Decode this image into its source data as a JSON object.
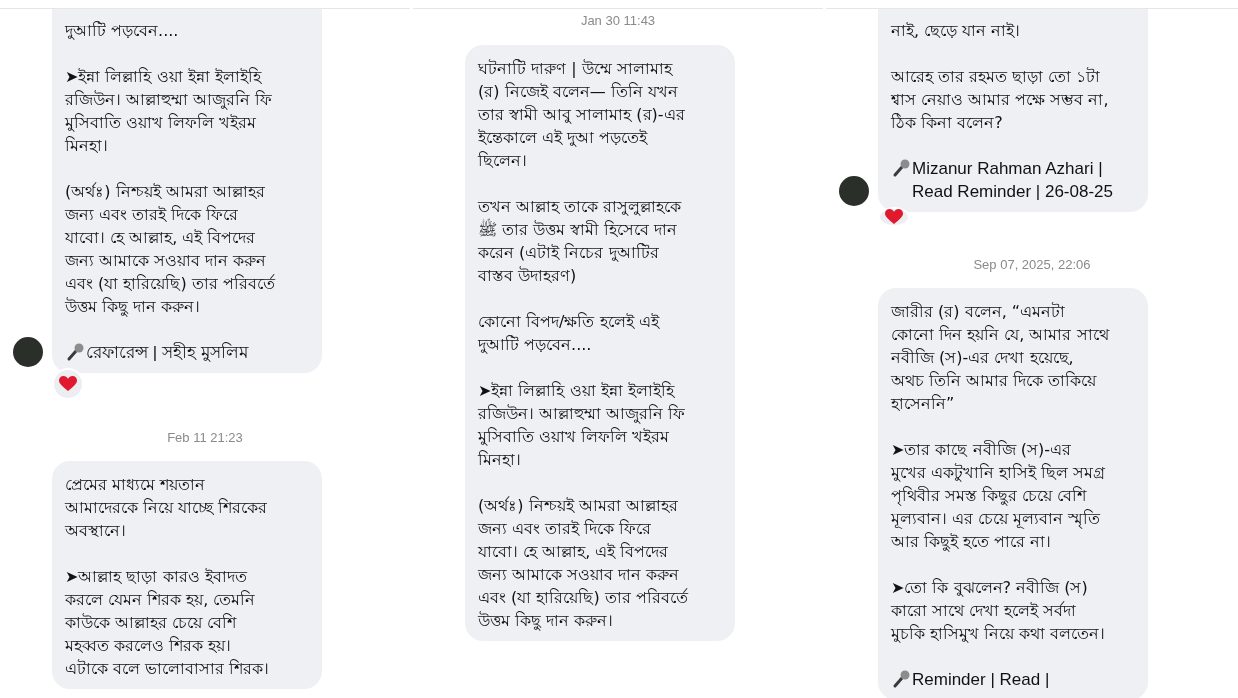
{
  "panels": [
    {
      "items": [
        {
          "kind": "message",
          "cut_top": true,
          "avatar": true,
          "heart_reaction": true,
          "paragraphs": [
            {
              "kind": "text",
              "lines": [
                "দুআটি পড়বেন...."
              ]
            },
            {
              "kind": "text",
              "lines": [
                "➤ইন্না লিল্লাহি ওয়া ইন্না ইলাইহি",
                "রজিউন। আল্লাহুম্মা আজুরনি ফি",
                "মুসিবাতি ওয়াখ লিফলি খইরম",
                "মিনহা।"
              ]
            },
            {
              "kind": "text",
              "lines": [
                "(অর্থঃ) নিশ্চয়ই আমরা আল্লাহর",
                "জন্য এবং তারই দিকে ফিরে",
                "যাবো। হে আল্লাহ, এই বিপদের",
                "জন্য আমাকে সওয়াব দান করুন",
                "এবং (যা হারিয়েছি) তার পরিবর্তে",
                "উত্তম কিছু দান করুন।"
              ]
            },
            {
              "kind": "signature",
              "lines": [
                "রেফারেন্স | সহীহ মুসলিম"
              ]
            }
          ]
        },
        {
          "kind": "timestamp",
          "text": "Feb 11 21:23"
        },
        {
          "kind": "message",
          "cut_top": false,
          "avatar": false,
          "heart_reaction": false,
          "paragraphs": [
            {
              "kind": "text",
              "lines": [
                "প্রেমের মাধ্যমে শয়তান",
                "আমাদেরকে নিয়ে যাচ্ছে শিরকের",
                "অবস্থানে।"
              ]
            },
            {
              "kind": "text",
              "lines": [
                "➤আল্লাহ ছাড়া কারও ইবাদত",
                "করলে যেমন শিরক হয়, তেমনি",
                "কাউকে আল্লাহর চেয়ে বেশি",
                "মহব্বত করলেও শিরক হয়।",
                "এটাকে বলে ভালোবাসার শিরক।"
              ]
            }
          ]
        }
      ]
    },
    {
      "items": [
        {
          "kind": "timestamp",
          "text": "Jan 30 11:43"
        },
        {
          "kind": "message",
          "cut_top": false,
          "avatar": false,
          "heart_reaction": false,
          "paragraphs": [
            {
              "kind": "text",
              "lines": [
                "ঘটনাটি দারুণ | উম্মে সালামাহ",
                "(র) নিজেই বলেন— তিনি যখন",
                "তার স্বামী আবু সালামাহ (র)-এর",
                "ইন্তেকালে এই দুআ পড়তেই",
                "ছিলেন।"
              ]
            },
            {
              "kind": "text",
              "lines": [
                "তখন আল্লাহ তাকে রাসুলুল্লাহকে",
                "ﷺ তার উত্তম স্বামী হিসেবে দান",
                "করেন (এটাই নিচের দুআটির",
                "বাস্তব উদাহরণ)"
              ]
            },
            {
              "kind": "text",
              "lines": [
                "কোনো বিপদ/ক্ষতি হলেই এই",
                "দুআটি পড়বেন...."
              ]
            },
            {
              "kind": "text",
              "lines": [
                "➤ইন্না লিল্লাহি ওয়া ইন্না ইলাইহি",
                "রজিউন। আল্লাহুম্মা আজুরনি ফি",
                "মুসিবাতি ওয়াখ লিফলি খইরম",
                "মিনহা।"
              ]
            },
            {
              "kind": "text",
              "lines": [
                "(অর্থঃ) নিশ্চয়ই আমরা আল্লাহর",
                "জন্য এবং তারই দিকে ফিরে",
                "যাবো। হে আল্লাহ, এই বিপদের",
                "জন্য আমাকে সওয়াব দান করুন",
                "এবং (যা হারিয়েছি) তার পরিবর্তে",
                "উত্তম কিছু দান করুন।"
              ]
            }
          ]
        }
      ]
    },
    {
      "items": [
        {
          "kind": "message",
          "cut_top": true,
          "avatar": true,
          "heart_reaction": true,
          "paragraphs": [
            {
              "kind": "text",
              "lines": [
                "নাই, ছেড়ে যান নাই।"
              ]
            },
            {
              "kind": "text",
              "lines": [
                "আরেহ তার রহমত ছাড়া তো ১টা",
                "শ্বাস নেয়াও আমার পক্ষে সম্ভব না,",
                "ঠিক কিনা বলেন?"
              ]
            },
            {
              "kind": "signature",
              "lines": [
                "Mizanur Rahman Azhari |",
                "Read Reminder | 26-08-25"
              ]
            }
          ]
        },
        {
          "kind": "timestamp",
          "text": "Sep 07, 2025, 22:06"
        },
        {
          "kind": "message",
          "cut_top": false,
          "avatar": false,
          "heart_reaction": false,
          "paragraphs": [
            {
              "kind": "text",
              "lines": [
                "জারীর (র) বলেন, “এমনটা",
                "কোনো দিন হয়নি যে, আমার সাথে",
                "নবীজি (স)-এর দেখা হয়েছে,",
                "অথচ তিনি আমার দিকে তাকিয়ে",
                "হাসেননি”"
              ]
            },
            {
              "kind": "text",
              "lines": [
                "➤তার কাছে নবীজি (স)-এর",
                "মুখের একটুখানি হাসিই ছিল সমগ্র",
                "পৃথিবীর সমস্ত কিছুর চেয়ে বেশি",
                "মূল্যবান। এর চেয়ে মূল্যবান স্মৃতি",
                "আর কিছুই হতে পারে না।"
              ]
            },
            {
              "kind": "text",
              "lines": [
                "➤তো কি বুঝলেন? নবীজি (স)",
                "কারো সাথে দেখা হলেই সর্বদা",
                "মুচকি হাসিমুখ নিয়ে কথা বলতেন।"
              ]
            },
            {
              "kind": "signature",
              "lines": [
                "Reminder | Read |"
              ]
            }
          ]
        }
      ]
    }
  ]
}
